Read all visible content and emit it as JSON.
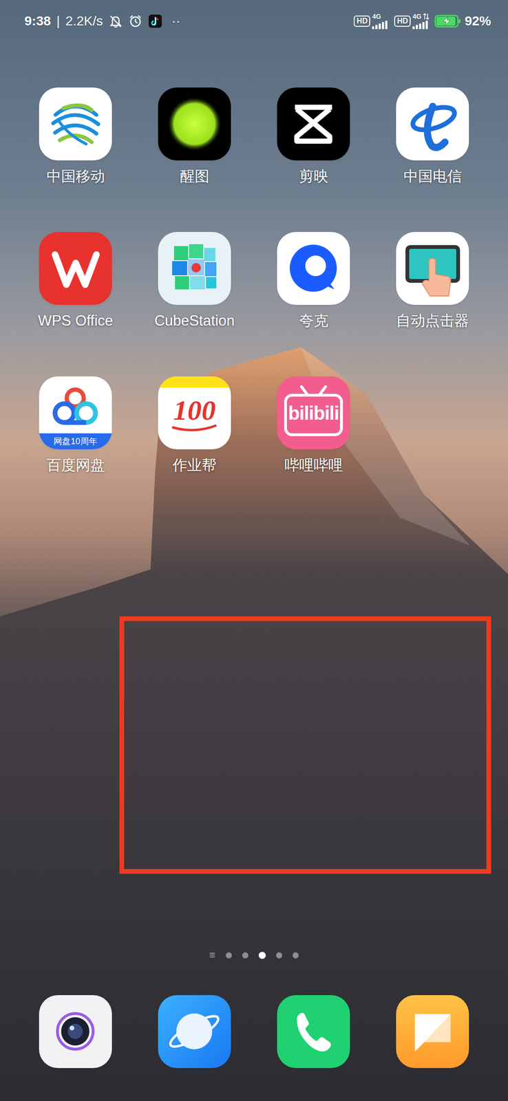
{
  "status_bar": {
    "time": "9:38",
    "separator": "|",
    "speed": "2.2K/s",
    "more": "··",
    "sims": [
      {
        "hd": "HD",
        "network": "4G",
        "level": 1,
        "data_active": false
      },
      {
        "hd": "HD",
        "network": "4G",
        "level": 1,
        "data_active": true
      }
    ],
    "battery": {
      "text": "92%",
      "level": 0.92,
      "charging": true
    }
  },
  "apps": [
    {
      "label": "中国移动",
      "kind": "cmcc"
    },
    {
      "label": "醒图",
      "kind": "xingtu"
    },
    {
      "label": "剪映",
      "kind": "jianying"
    },
    {
      "label": "中国电信",
      "kind": "telecom"
    },
    {
      "label": "WPS Office",
      "kind": "wps"
    },
    {
      "label": "CubeStation",
      "kind": "cube"
    },
    {
      "label": "夸克",
      "kind": "quark"
    },
    {
      "label": "自动点击器",
      "kind": "clicker"
    },
    {
      "label": "百度网盘",
      "kind": "pan",
      "icon_text": "网盘10周年"
    },
    {
      "label": "作业帮",
      "kind": "zyb",
      "icon_text": "100"
    },
    {
      "label": "哔哩哔哩",
      "kind": "bili",
      "icon_text": "bilibili"
    }
  ],
  "page_indicator": {
    "menu": "≡",
    "dots": [
      {
        "selected": false
      },
      {
        "selected": false
      },
      {
        "selected": true
      },
      {
        "selected": false
      },
      {
        "selected": false
      }
    ]
  },
  "dock": [
    {
      "kind": "camera"
    },
    {
      "kind": "browser"
    },
    {
      "kind": "phone"
    },
    {
      "kind": "messages"
    }
  ]
}
